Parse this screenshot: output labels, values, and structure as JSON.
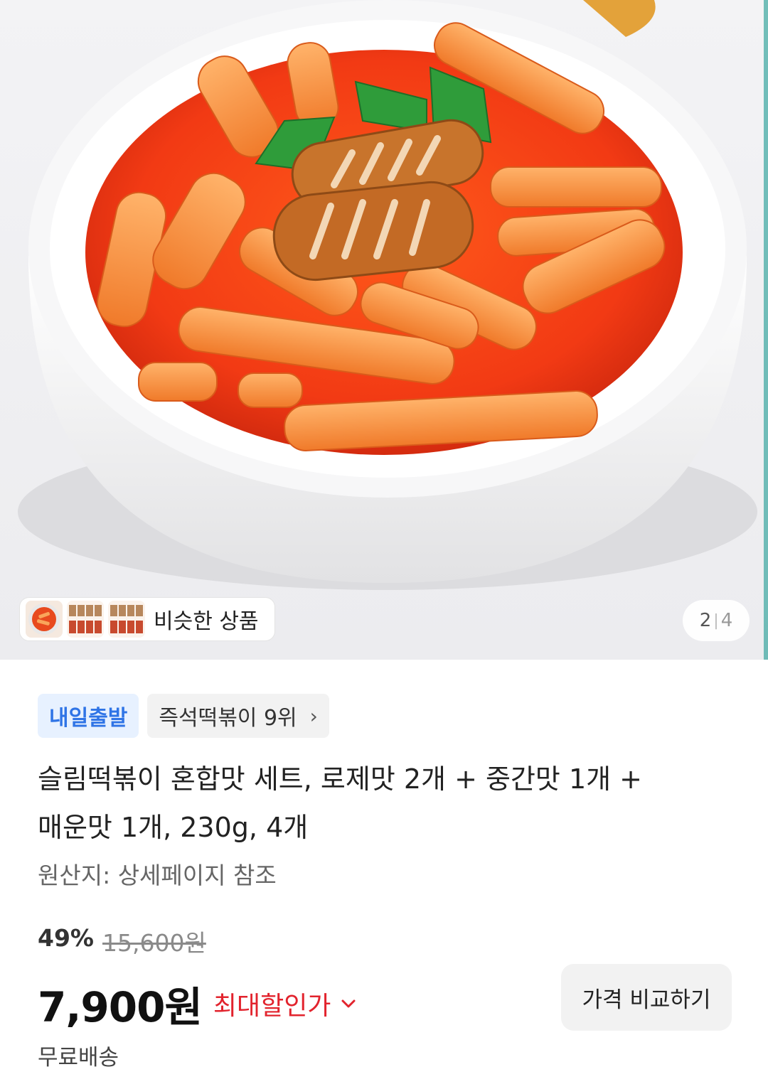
{
  "hero": {
    "similar_label": "비슷한 상품",
    "pager_current": "2",
    "pager_total": "4"
  },
  "badges": {
    "delivery": "내일출발",
    "rank": "즉석떡볶이 9위"
  },
  "product": {
    "title_line1": "슬림떡볶이 혼합맛 세트, 로제맛 2개 + 중간맛 1개 +",
    "title_line2": "매운맛 1개, 230g, 4개",
    "origin": "원산지: 상세페이지 참조"
  },
  "pricing": {
    "discount_percent": "49%",
    "original_price": "15,600원",
    "price": "7,900원",
    "max_discount_label": "최대할인가",
    "compare_button": "가격 비교하기",
    "shipping": "무료배송"
  },
  "colors": {
    "accent_red": "#e2232d",
    "badge_blue": "#2f74e6"
  }
}
